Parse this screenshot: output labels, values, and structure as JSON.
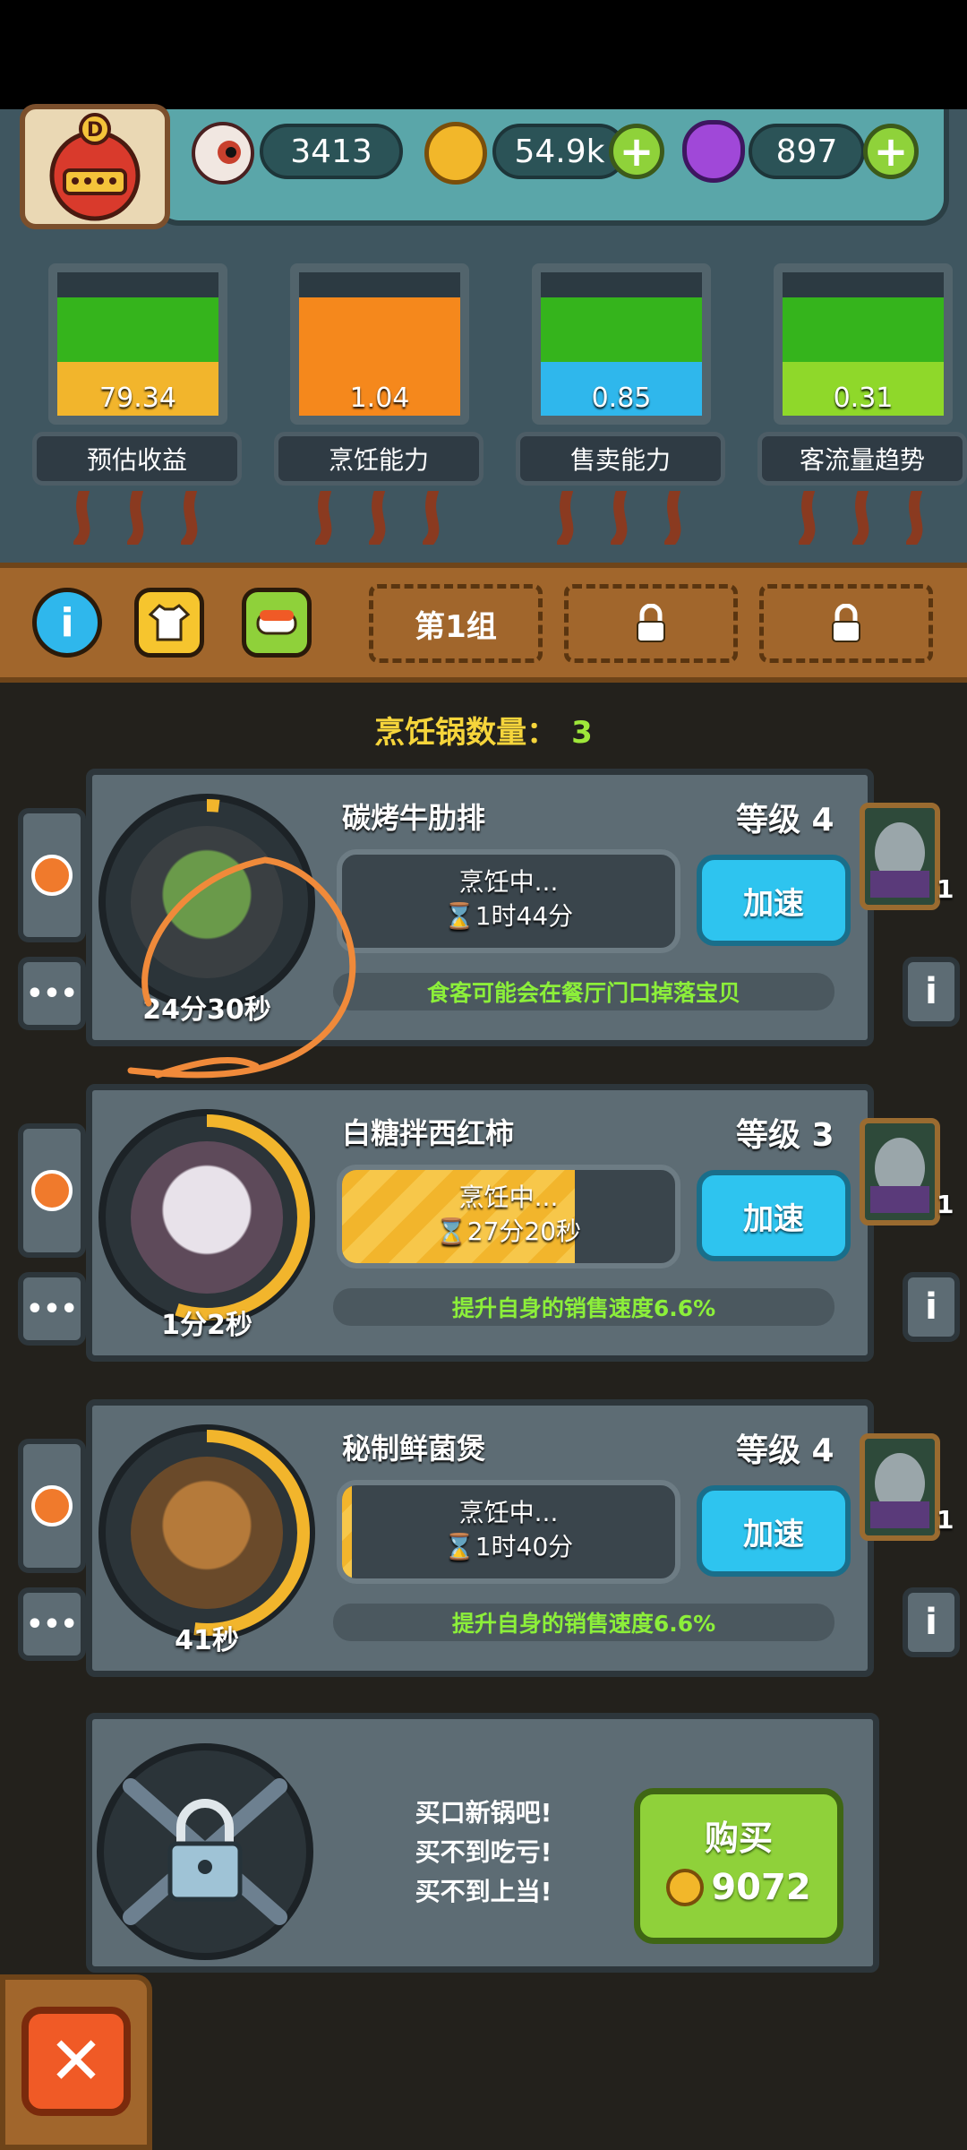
{
  "resources": {
    "eyeball": {
      "icon": "eyeball-icon",
      "value": "3413"
    },
    "coins": {
      "icon": "coin-icon",
      "value": "54.9k"
    },
    "potion": {
      "icon": "potion-icon",
      "value": "897"
    }
  },
  "gauges": [
    {
      "value": "79.34",
      "label": "预估收益",
      "bottom_color": "#f2b52c",
      "top_color": "#35b41c"
    },
    {
      "value": "1.04",
      "label": "烹饪能力",
      "bottom_color": "#f5881c",
      "top_color": "#f5881c"
    },
    {
      "value": "0.85",
      "label": "售卖能力",
      "bottom_color": "#2fb7ec",
      "top_color": "#35b41c"
    },
    {
      "value": "0.31",
      "label": "客流量趋势",
      "bottom_color": "#8fd82a",
      "top_color": "#35b41c"
    }
  ],
  "toolbar": {
    "group_tab": "第1组"
  },
  "pot_count": {
    "label": "烹饪锅数量：",
    "value": "3"
  },
  "cards": [
    {
      "dish": "碳烤牛肋排",
      "level": "等级 4",
      "status": "烹饪中...",
      "time_left": "1时44分",
      "progress": 0.0,
      "pot_timer": "24分30秒",
      "perk": "食客可能会在餐厅门口掉落宝贝",
      "speed": "加速",
      "chef_badge": "1"
    },
    {
      "dish": "白糖拌西红柿",
      "level": "等级 3",
      "status": "烹饪中...",
      "time_left": "27分20秒",
      "progress": 0.7,
      "pot_timer": "1分2秒",
      "perk": "提升自身的销售速度6.6%",
      "speed": "加速",
      "chef_badge": "1"
    },
    {
      "dish": "秘制鲜菌煲",
      "level": "等级 4",
      "status": "烹饪中...",
      "time_left": "1时40分",
      "progress": 0.03,
      "pot_timer": "41秒",
      "perk": "提升自身的销售速度6.6%",
      "speed": "加速",
      "chef_badge": "1"
    }
  ],
  "buy": {
    "lines": [
      "买口新锅吧!",
      "买不到吃亏!",
      "买不到上当!"
    ],
    "button_label": "购买",
    "price": "9072"
  },
  "side_labels": {
    "more": "•••",
    "info": "i"
  },
  "close": "✕"
}
